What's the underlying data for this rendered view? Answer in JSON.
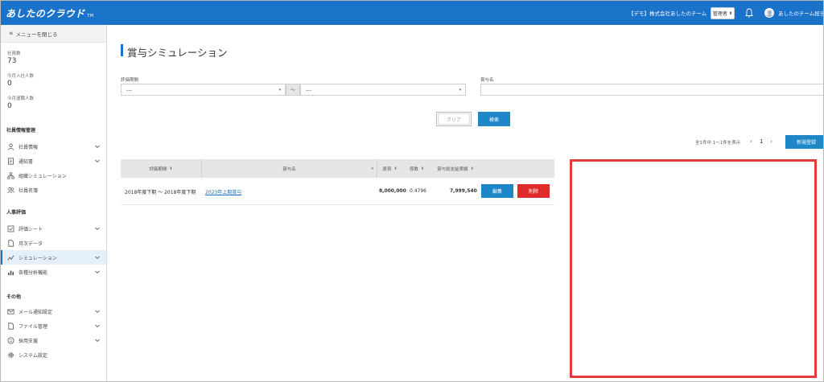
{
  "header": {
    "logo": "あしたのクラウド",
    "logo_sub": "TM",
    "company": "【デモ】株式会社あしたのチーム",
    "role": "管理者",
    "username": "あしたのチーム担当者"
  },
  "sidebar": {
    "collapse_label": "メニューを閉じる",
    "stats": [
      {
        "label": "社員数",
        "value": "73"
      },
      {
        "label": "今月入社人数",
        "value": "0"
      },
      {
        "label": "今月退職人数",
        "value": "0"
      }
    ],
    "sections": [
      {
        "title": "社員情報管理",
        "items": [
          {
            "label": "社員情報",
            "icon": "person-icon",
            "expandable": true
          },
          {
            "label": "通知書",
            "icon": "document-icon",
            "expandable": true
          },
          {
            "label": "組織シミュレーション",
            "icon": "org-chart-icon",
            "expandable": false
          },
          {
            "label": "社員名簿",
            "icon": "people-icon",
            "expandable": false
          }
        ]
      },
      {
        "title": "人事評価",
        "items": [
          {
            "label": "評価シート",
            "icon": "checklist-icon",
            "expandable": true
          },
          {
            "label": "月次データ",
            "icon": "file-icon",
            "expandable": false
          },
          {
            "label": "シミュレーション",
            "icon": "simulation-icon",
            "expandable": true,
            "active": true
          },
          {
            "label": "各種分析機能",
            "icon": "bar-chart-icon",
            "expandable": true
          }
        ]
      },
      {
        "title": "その他",
        "items": [
          {
            "label": "メール通知設定",
            "icon": "mail-icon",
            "expandable": true
          },
          {
            "label": "ファイル管理",
            "icon": "file-icon",
            "expandable": true
          },
          {
            "label": "採用支援",
            "icon": "smile-icon",
            "expandable": true
          },
          {
            "label": "システム設定",
            "icon": "gear-icon",
            "expandable": false
          }
        ]
      }
    ]
  },
  "main": {
    "title": "賞与シミュレーション",
    "filters": {
      "period_label": "評価期間",
      "period_from": "---",
      "tilde": "～",
      "period_to": "---",
      "bonus_name_label": "賞与名",
      "bonus_name_value": ""
    },
    "clear_label": "クリア",
    "search_label": "検索",
    "pager": {
      "info": "全1件中 1～1件を表示",
      "prev": "‹",
      "page": "1",
      "next": "›"
    },
    "new_label": "新規登録",
    "table": {
      "headers": [
        "評価期間",
        "賞与名",
        "原資",
        "係数",
        "賞与総支給実績"
      ],
      "rows": [
        {
          "period": "2018年度下期 ～ 2018年度下期",
          "name": "2023年上期賞与",
          "fund": "8,000,000",
          "coef": "0.4796",
          "total": "7,999,540"
        }
      ],
      "edit_label": "編集",
      "delete_label": "削除"
    }
  },
  "colors": {
    "brand": "#1b72c9",
    "button": "#1d87c8",
    "danger": "#e02b2b",
    "highlight": "#e23b3b"
  }
}
